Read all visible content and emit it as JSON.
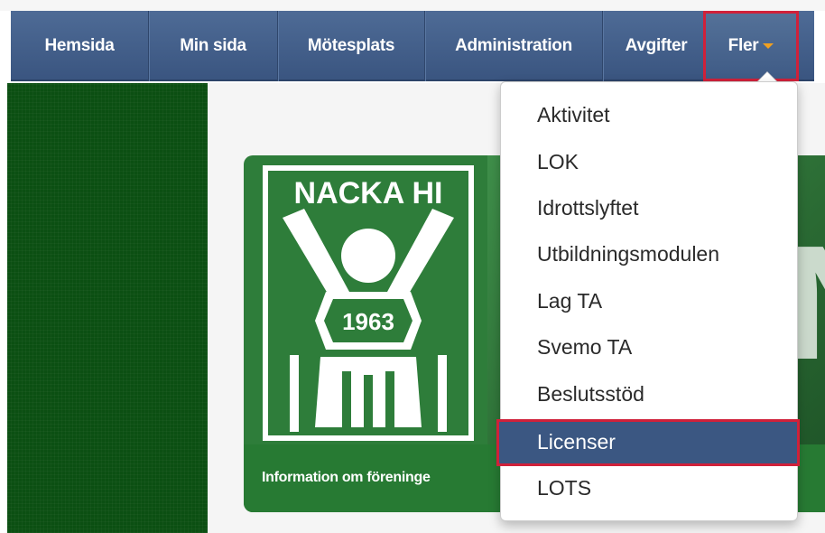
{
  "navbar": {
    "items": [
      {
        "label": "Hemsida"
      },
      {
        "label": "Min sida"
      },
      {
        "label": "Mötesplats"
      },
      {
        "label": "Administration"
      },
      {
        "label": "Avgifter"
      },
      {
        "label": "Fler"
      }
    ]
  },
  "dropdown": {
    "items": [
      {
        "label": "Aktivitet"
      },
      {
        "label": "LOK"
      },
      {
        "label": "Idrottslyftet"
      },
      {
        "label": "Utbildningsmodulen"
      },
      {
        "label": "Lag TA"
      },
      {
        "label": "Svemo TA"
      },
      {
        "label": "Beslutsstöd"
      },
      {
        "label": "Licenser"
      },
      {
        "label": "LOTS"
      }
    ],
    "highlighted_index": 7
  },
  "banner": {
    "caption": "Information om föreninge",
    "logo": {
      "name": "NACKA HI",
      "year": "1963"
    }
  },
  "colors": {
    "navbar": "#3d5a85",
    "highlight_outline": "#d0213a",
    "club_green": "#2e7d3a",
    "dark_green": "#0b4f12",
    "menu_highlight": "#3b5782"
  }
}
